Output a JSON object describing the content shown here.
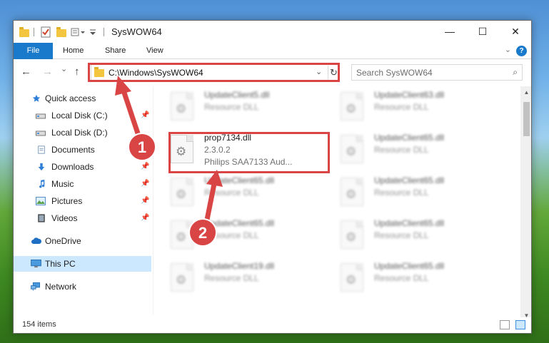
{
  "window": {
    "title": "SysWOW64",
    "controls": {
      "minimize": "—",
      "maximize": "☐",
      "close": "✕"
    }
  },
  "ribbon": {
    "file": "File",
    "home": "Home",
    "share": "Share",
    "view": "View",
    "help": "?"
  },
  "address": {
    "path": "C:\\Windows\\SysWOW64",
    "dropdown": "⌄",
    "refresh": "↻"
  },
  "search": {
    "placeholder": "Search SysWOW64",
    "icon": "⌕"
  },
  "nav": {
    "back": "←",
    "forward": "→",
    "recent": "⌄",
    "up": "↑",
    "items": [
      {
        "label": "Quick access",
        "icon": "star-icon"
      },
      {
        "label": "Local Disk (C:)",
        "icon": "drive-icon",
        "pinned": true
      },
      {
        "label": "Local Disk (D:)",
        "icon": "drive-icon"
      },
      {
        "label": "Documents",
        "icon": "documents-icon",
        "pinned": true
      },
      {
        "label": "Downloads",
        "icon": "download-icon",
        "pinned": true
      },
      {
        "label": "Music",
        "icon": "music-icon",
        "pinned": true
      },
      {
        "label": "Pictures",
        "icon": "pictures-icon",
        "pinned": true
      },
      {
        "label": "Videos",
        "icon": "videos-icon",
        "pinned": true
      },
      {
        "label": "OneDrive",
        "icon": "cloud-icon"
      },
      {
        "label": "This PC",
        "icon": "computer-icon",
        "selected": true
      },
      {
        "label": "Network",
        "icon": "network-icon"
      }
    ],
    "pin_glyph": "📌"
  },
  "files": {
    "left_column": [
      {
        "name": "UpdateClient5.dll",
        "type": "Resource DLL"
      },
      {
        "name": "prop7134.dll",
        "version": "2.3.0.2",
        "description": "Philips SAA7133 Aud...",
        "highlighted": true
      },
      {
        "name": "UpdateClient65.dll",
        "type": "Resource DLL"
      },
      {
        "name": "UpdateClient65.dll",
        "type": "Resource DLL"
      },
      {
        "name": "UpdateClient19.dll",
        "type": "Resource DLL"
      }
    ],
    "right_column": [
      {
        "name": "UpdateClient63.dll",
        "type": "Resource DLL"
      },
      {
        "name": "UpdateClient65.dll",
        "type": "Resource DLL"
      },
      {
        "name": "UpdateClient65.dll",
        "type": "Resource DLL"
      },
      {
        "name": "UpdateClient65.dll",
        "type": "Resource DLL"
      },
      {
        "name": "UpdateClient65.dll",
        "type": "Resource DLL"
      }
    ]
  },
  "status": {
    "item_count": "154 items"
  },
  "annotations": {
    "step1": "1",
    "step2": "2",
    "color": "#d94545"
  }
}
